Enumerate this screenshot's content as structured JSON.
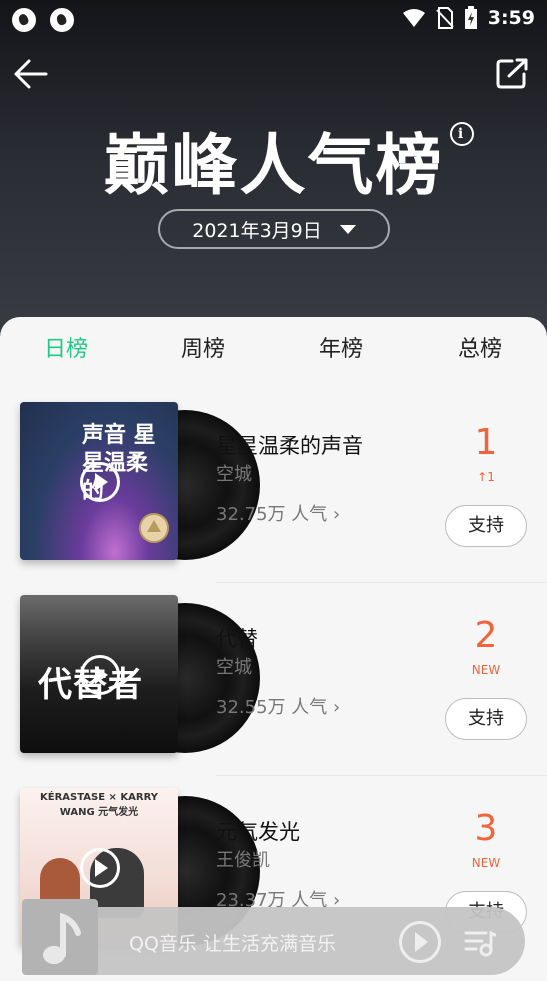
{
  "status_bar": {
    "time": "3:59"
  },
  "header": {
    "title": "巅峰人气榜",
    "info_icon": "i",
    "date": "2021年3月9日"
  },
  "tabs": [
    {
      "label": "日榜",
      "active": true
    },
    {
      "label": "周榜",
      "active": false
    },
    {
      "label": "年榜",
      "active": false
    },
    {
      "label": "总榜",
      "active": false
    }
  ],
  "items": [
    {
      "song": "星星温柔的声音",
      "artist": "空城",
      "popularity": "32.75万 人气",
      "rank": "1",
      "change": "↑1",
      "support": "支持",
      "cover_text": "声音 星星温柔的"
    },
    {
      "song": "代替",
      "artist": "空城",
      "popularity": "32.55万 人气",
      "rank": "2",
      "change": "NEW",
      "support": "支持",
      "cover_text": "代替者"
    },
    {
      "song": "元气发光",
      "artist": "王俊凯",
      "popularity": "23.37万 人气",
      "rank": "3",
      "change": "NEW",
      "support": "支持",
      "cover_text": "KÉRASTASE × KARRY WANG 元气发光"
    }
  ],
  "player": {
    "text": "QQ音乐 让生活充满音乐"
  },
  "colors": {
    "accent": "#20c985",
    "rank": "#f0633b"
  }
}
